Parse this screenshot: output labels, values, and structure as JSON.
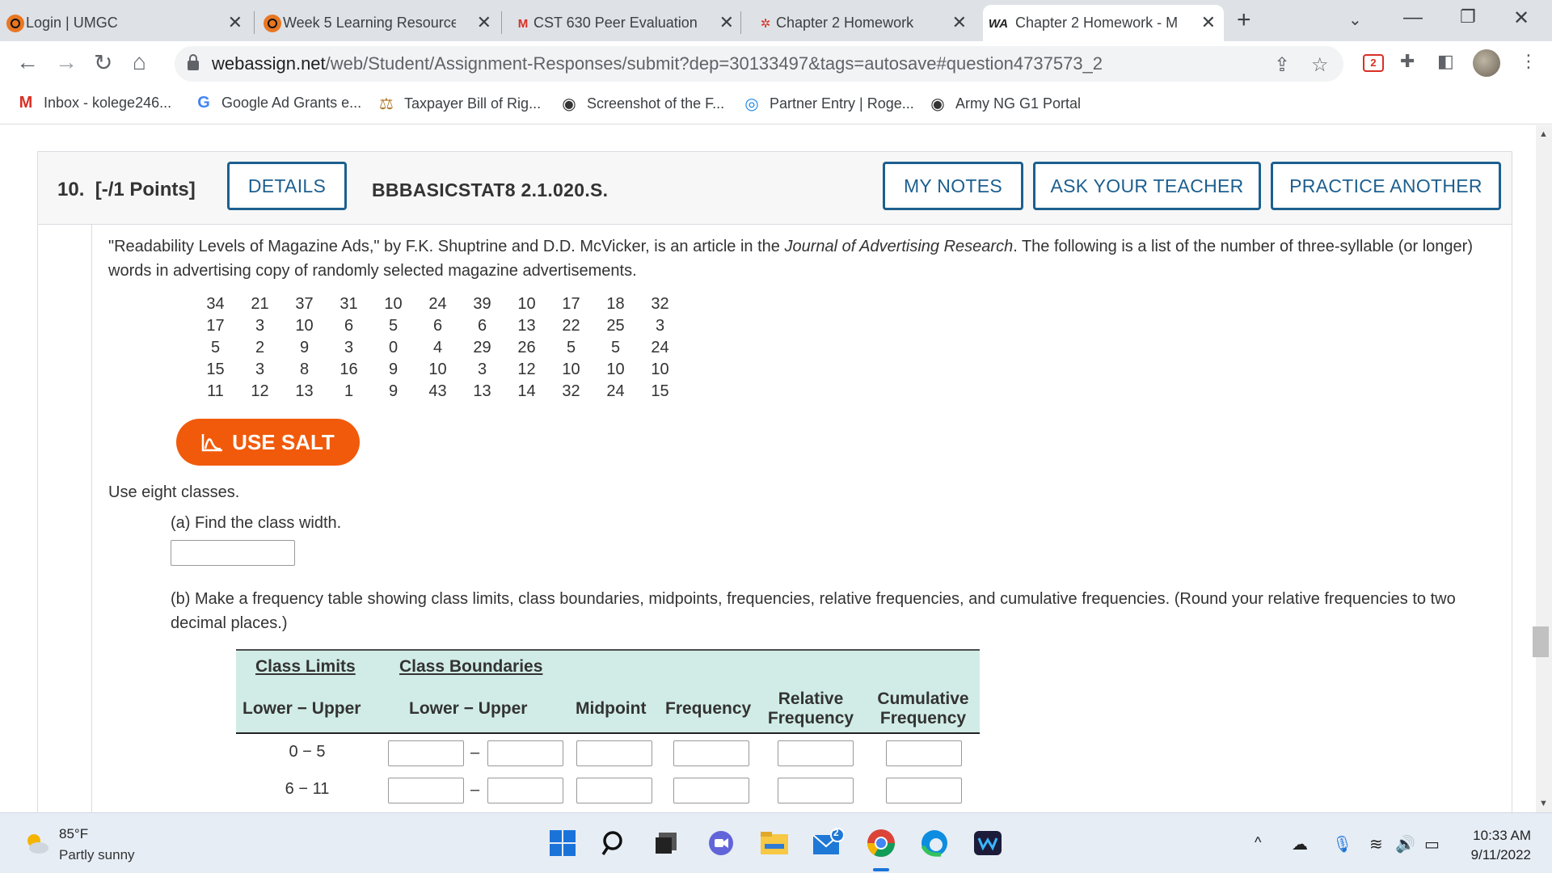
{
  "browser": {
    "tabs": [
      {
        "title": "Login | UMGC",
        "icon": "umgc-icon"
      },
      {
        "title": "Week 5 Learning Resource",
        "icon": "umgc-icon"
      },
      {
        "title": "CST 630 Peer Evaluation -",
        "icon": "gmail-icon"
      },
      {
        "title": "Chapter 2 Homework",
        "icon": "chapter-icon"
      },
      {
        "title": "Chapter 2 Homework - M",
        "icon": "webassign-icon",
        "active": true
      }
    ],
    "url_host": "webassign.net",
    "url_path": "/web/Student/Assignment-Responses/submit?dep=30133497&tags=autosave#question4737573_2",
    "extension_badge": "2",
    "bookmarks": [
      {
        "label": "Inbox - kolege246...",
        "icon": "gmail-icon"
      },
      {
        "label": "Google Ad Grants e...",
        "icon": "google-icon"
      },
      {
        "label": "Taxpayer Bill of Rig...",
        "icon": "taxpayer-icon"
      },
      {
        "label": "Screenshot of the F...",
        "icon": "globe-icon"
      },
      {
        "label": "Partner Entry | Roge...",
        "icon": "partner-icon"
      },
      {
        "label": "Army NG G1 Portal",
        "icon": "globe-icon"
      }
    ]
  },
  "question": {
    "number": "10.",
    "points": "[-/1 Points]",
    "details_label": "DETAILS",
    "reference": "BBBASICSTAT8 2.1.020.S.",
    "my_notes_label": "MY NOTES",
    "ask_teacher_label": "ASK YOUR TEACHER",
    "practice_label": "PRACTICE ANOTHER",
    "intro_pre": "\"Readability Levels of Magazine Ads,\" by F.K. Shuptrine and D.D. McVicker, is an article in the ",
    "intro_journal": "Journal of Advertising Research",
    "intro_post": ". The following is a list of the number of three-syllable (or longer) words in advertising copy of randomly selected magazine advertisements.",
    "data_rows": [
      [
        "34",
        "21",
        "37",
        "31",
        "10",
        "24",
        "39",
        "10",
        "17",
        "18",
        "32"
      ],
      [
        "17",
        "3",
        "10",
        "6",
        "5",
        "6",
        "6",
        "13",
        "22",
        "25",
        "3"
      ],
      [
        "5",
        "2",
        "9",
        "3",
        "0",
        "4",
        "29",
        "26",
        "5",
        "5",
        "24"
      ],
      [
        "15",
        "3",
        "8",
        "16",
        "9",
        "10",
        "3",
        "12",
        "10",
        "10",
        "10"
      ],
      [
        "11",
        "12",
        "13",
        "1",
        "9",
        "43",
        "13",
        "14",
        "32",
        "24",
        "15"
      ]
    ],
    "salt_label": "USE SALT",
    "use_classes": "Use eight classes.",
    "part_a": "(a) Find the class width.",
    "part_b": "(b) Make a frequency table showing class limits, class boundaries, midpoints, frequencies, relative frequencies, and cumulative frequencies. (Round your relative frequencies to two decimal places.)",
    "table": {
      "class_limits": "Class Limits",
      "class_boundaries": "Class Boundaries",
      "lower_upper": "Lower − Upper",
      "midpoint": "Midpoint",
      "frequency": "Frequency",
      "relative_frequency_1": "Relative",
      "relative_frequency_2": "Frequency",
      "cumulative_frequency_1": "Cumulative",
      "cumulative_frequency_2": "Frequency",
      "rows": [
        {
          "limits": "0 − 5"
        },
        {
          "limits": "6 − 11"
        }
      ]
    }
  },
  "taskbar": {
    "temperature": "85°F",
    "condition": "Partly sunny",
    "time": "10:33 AM",
    "date": "9/11/2022",
    "mail_badge": "2"
  },
  "colors": {
    "accent_blue": "#1d5f8f",
    "salt_orange": "#f15a0a",
    "table_header": "#d1ece6"
  }
}
